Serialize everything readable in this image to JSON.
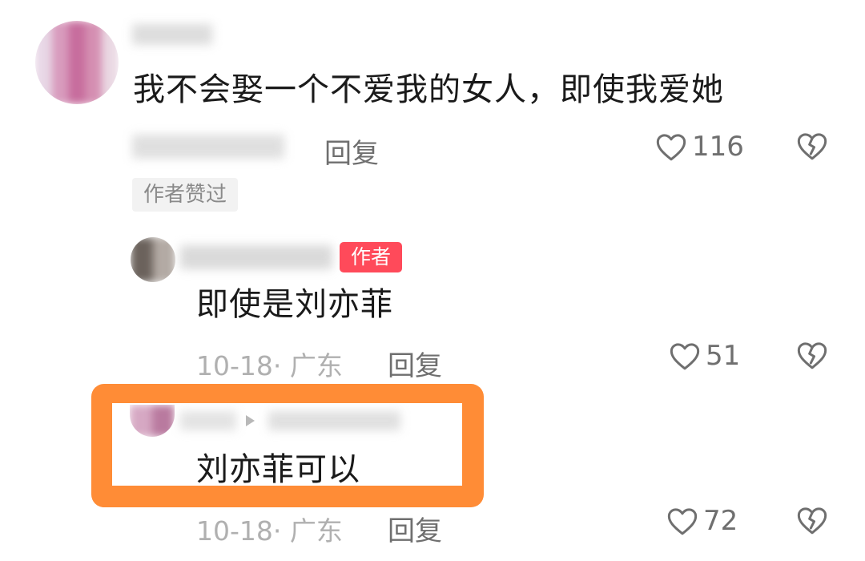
{
  "comments": [
    {
      "text": "我不会娶一个不爱我的女人，即使我爱她",
      "reply_label": "回复",
      "likes": "116",
      "liked_by_author": "作者赞过"
    },
    {
      "author_badge": "作者",
      "text": "即使是刘亦菲",
      "date": "10-18",
      "location": "广东",
      "reply_label": "回复",
      "likes": "51"
    },
    {
      "text": "刘亦菲可以",
      "date": "10-18",
      "location": "广东",
      "reply_label": "回复",
      "likes": "72"
    }
  ],
  "colors": {
    "highlight": "#ff8c36",
    "author_badge": "#ff4a5a",
    "meta_text": "#b0b0b0",
    "action_text": "#6f6f6f"
  },
  "icons": {
    "like": "heart-outline-icon",
    "dislike": "broken-heart-icon"
  }
}
